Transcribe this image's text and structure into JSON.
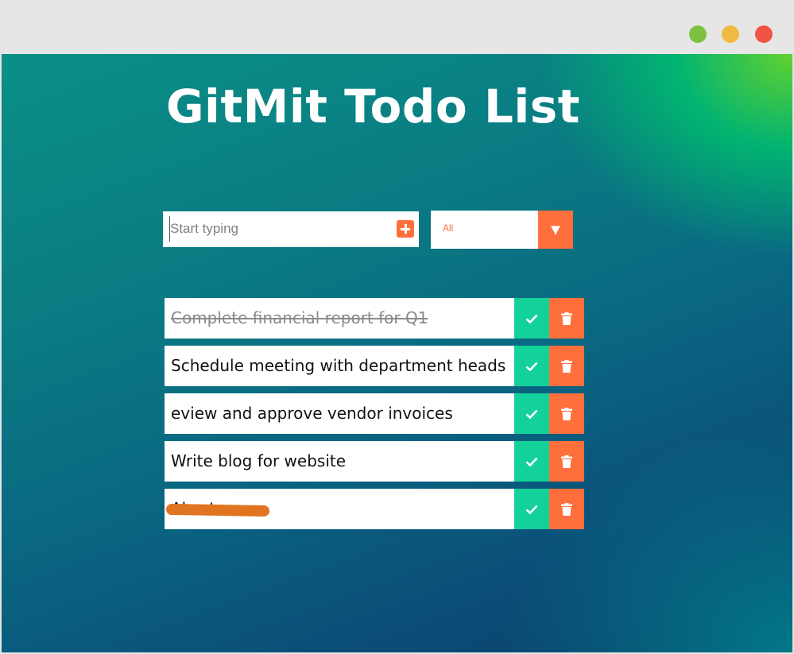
{
  "window": {
    "controls": [
      {
        "name": "minimize",
        "color": "#7cc242"
      },
      {
        "name": "maximize",
        "color": "#f0b941"
      },
      {
        "name": "close",
        "color": "#f25443"
      }
    ]
  },
  "app": {
    "title": "GitMit Todo List"
  },
  "add_todo": {
    "placeholder": "Start typing",
    "value": "",
    "button_icon": "plus-square-icon"
  },
  "filter": {
    "selected": "All",
    "arrow": "▼"
  },
  "colors": {
    "accent_orange": "#ff6f3c",
    "check_green": "#12d19a"
  },
  "todos": [
    {
      "text": "Complete financial report for Q1",
      "completed": true
    },
    {
      "text": "Schedule meeting with department heads",
      "completed": false
    },
    {
      "text": "eview and approve vendor invoices",
      "completed": false
    },
    {
      "text": "Write blog for website",
      "completed": false
    },
    {
      "text": "Also t",
      "completed": false,
      "redacted": true
    }
  ]
}
